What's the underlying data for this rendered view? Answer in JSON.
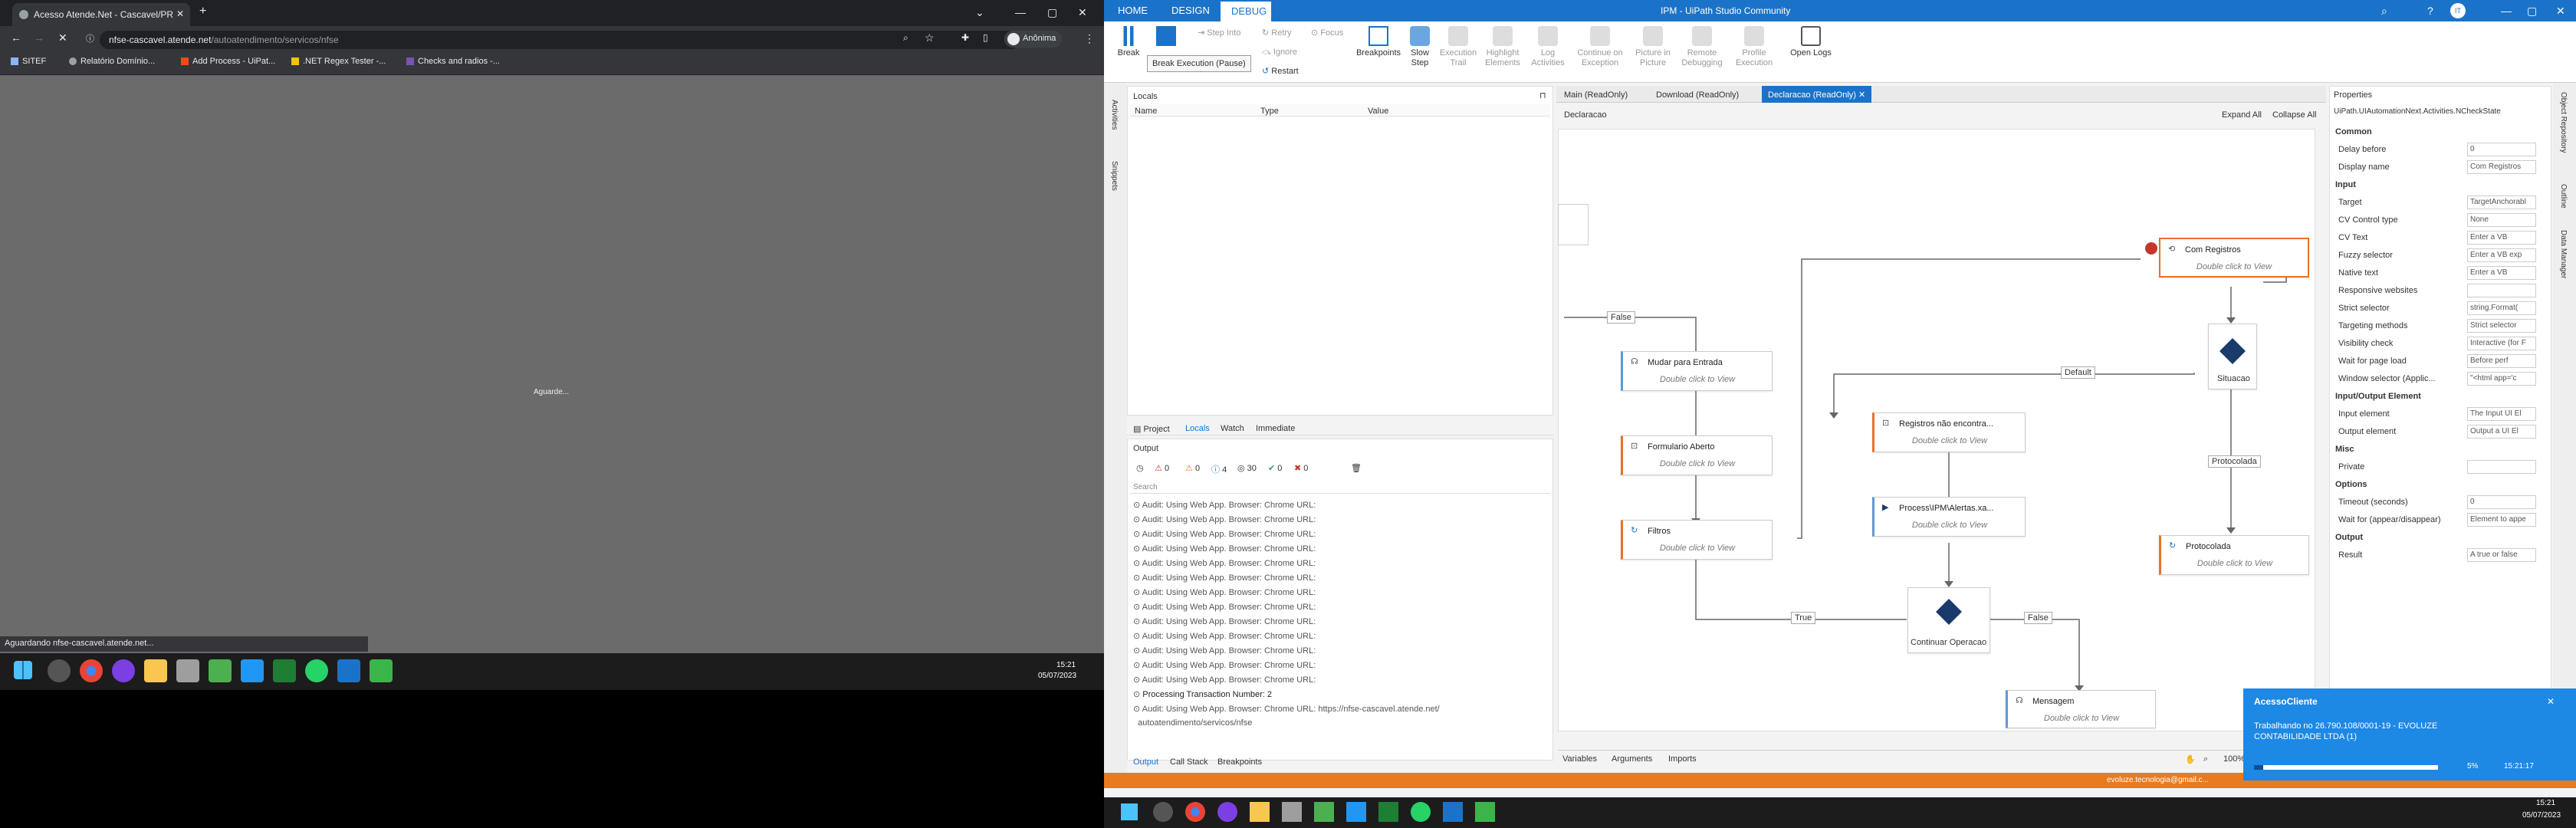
{
  "browser": {
    "tab_title": "Acesso Atende.Net - Cascavel/PR",
    "url_prefix": "nfse-cascavel.atende.net",
    "url_suffix": "/autoatendimento/servicos/nfse",
    "profile": "Anônima",
    "bookmarks": [
      "SITEF",
      "Relatório Domínio...",
      "Add Process - UiPat...",
      ".NET Regex Tester -...",
      "Checks and radios -..."
    ],
    "loading_text": "Aguarde...",
    "status_text": "Aguardando nfse-cascavel.atende.net...",
    "clock_time": "15:21",
    "clock_date": "05/07/2023"
  },
  "studio": {
    "title": "IPM - UiPath Studio Community",
    "ribbon_tabs": [
      "HOME",
      "DESIGN",
      "DEBUG"
    ],
    "ribbon_buttons": [
      "Break",
      "Step Into",
      "Retry",
      "Focus",
      "Ignore",
      "Restart",
      "Breakpoints",
      "Slow Step",
      "Execution Trail",
      "Highlight Elements",
      "Log Activities",
      "Continue on Exception",
      "Picture in Picture",
      "Remote Debugging",
      "Profile Execution",
      "Open Logs"
    ],
    "tooltip": "Break Execution (Pause)",
    "locals": {
      "title": "Locals",
      "cols": [
        "Name",
        "Type",
        "Value"
      ]
    },
    "panel_tabs": [
      "Project",
      "Locals",
      "Watch",
      "Immediate"
    ],
    "output": {
      "title": "Output",
      "counts": [
        "0",
        "0",
        "4",
        "30",
        "0",
        "0"
      ],
      "search": "Search",
      "lines": [
        "Audit: Using Web App. Browser: Chrome URL:",
        "Audit: Using Web App. Browser: Chrome URL:",
        "Audit: Using Web App. Browser: Chrome URL:",
        "Audit: Using Web App. Browser: Chrome URL:",
        "Audit: Using Web App. Browser: Chrome URL:",
        "Audit: Using Web App. Browser: Chrome URL:",
        "Audit: Using Web App. Browser: Chrome URL:",
        "Audit: Using Web App. Browser: Chrome URL:",
        "Audit: Using Web App. Browser: Chrome URL:",
        "Audit: Using Web App. Browser: Chrome URL:",
        "Audit: Using Web App. Browser: Chrome URL:",
        "Audit: Using Web App. Browser: Chrome URL:",
        "Audit: Using Web App. Browser: Chrome URL:",
        "Processing Transaction Number: 2",
        "Audit: Using Web App. Browser: Chrome URL: https://nfse-cascavel.atende.net/",
        "autoatendimento/servicos/nfse"
      ],
      "bottom_tabs": [
        "Output",
        "Call Stack",
        "Breakpoints"
      ]
    },
    "doc_tabs": [
      "Main (ReadOnly)",
      "Download (ReadOnly)",
      "Declaracao (ReadOnly)"
    ],
    "breadcrumb": "Declaracao",
    "expand_all": "Expand All",
    "collapse_all": "Collapse All",
    "activities": {
      "com_registros": "Com Registros",
      "mudar": "Mudar para Entrada",
      "formulario": "Formulario Aberto",
      "filtros": "Filtros",
      "registros_nao": "Registros não encontra...",
      "process": "Process\\IPM\\Alertas.xa...",
      "protocolada": "Protocolada",
      "mensagem": "Mensagem",
      "sub": "Double click to View"
    },
    "flow_labels": {
      "false1": "False",
      "default": "Default",
      "situacao": "Situacao",
      "protocolada": "Protocolada",
      "true": "True",
      "false2": "False",
      "continuar": "Continuar Operacao"
    },
    "designer_bottom": [
      "Variables",
      "Arguments",
      "Imports"
    ],
    "zoom": "100%",
    "properties": {
      "title": "Properties",
      "type": "UiPath.UIAutomationNext.Activities.NCheckState",
      "rows": [
        {
          "s": "Common"
        },
        {
          "k": "Delay before",
          "v": "0"
        },
        {
          "k": "Display name",
          "v": "Com Registros"
        },
        {
          "s": "Input"
        },
        {
          "k": "Target",
          "v": "TargetAnchorabl"
        },
        {
          "k": "CV Control type",
          "v": "None"
        },
        {
          "k": "CV Text",
          "v": "Enter a VB"
        },
        {
          "k": "Fuzzy selector",
          "v": "Enter a VB exp"
        },
        {
          "k": "Native text",
          "v": "Enter a VB"
        },
        {
          "k": "Responsive websites",
          "v": ""
        },
        {
          "k": "Strict selector",
          "v": "string.Format("
        },
        {
          "k": "Targeting methods",
          "v": "Strict selector"
        },
        {
          "k": "Visibility check",
          "v": "Interactive (for F"
        },
        {
          "k": "Wait for page load",
          "v": "Before perf"
        },
        {
          "k": "Window selector (Applic...",
          "v": "\"<html app='c"
        },
        {
          "s": "Input/Output Element"
        },
        {
          "k": "Input element",
          "v": "The Input UI El"
        },
        {
          "k": "Output element",
          "v": "Output a UI El"
        },
        {
          "s": "Misc"
        },
        {
          "k": "Private",
          "v": ""
        },
        {
          "s": "Options"
        },
        {
          "k": "Timeout (seconds)",
          "v": "0"
        },
        {
          "k": "Wait for (appear/disappear)",
          "v": "Element to appe"
        },
        {
          "s": "Output"
        },
        {
          "k": "Result",
          "v": "A true or false"
        }
      ]
    },
    "side_tabs": [
      "Object Repository",
      "Outline",
      "Data Manager"
    ],
    "left_side_tabs": [
      "Activities",
      "Snippets"
    ],
    "toast": {
      "title": "AcessoCliente",
      "body": "Trabalhando no 26.790.108/0001-19 - EVOLUZE CONTABILIDADE LTDA (1)",
      "percent": "5%",
      "progress": 0.05,
      "time": "15:21:17"
    },
    "email": "evoluze.tecnologia@gmail.c...",
    "clock_time": "15:21",
    "clock_date": "05/07/2023"
  },
  "colors": {
    "accent": "#1a73c9",
    "orange": "#ea7a1f",
    "breakpoint": "#c0392b"
  }
}
